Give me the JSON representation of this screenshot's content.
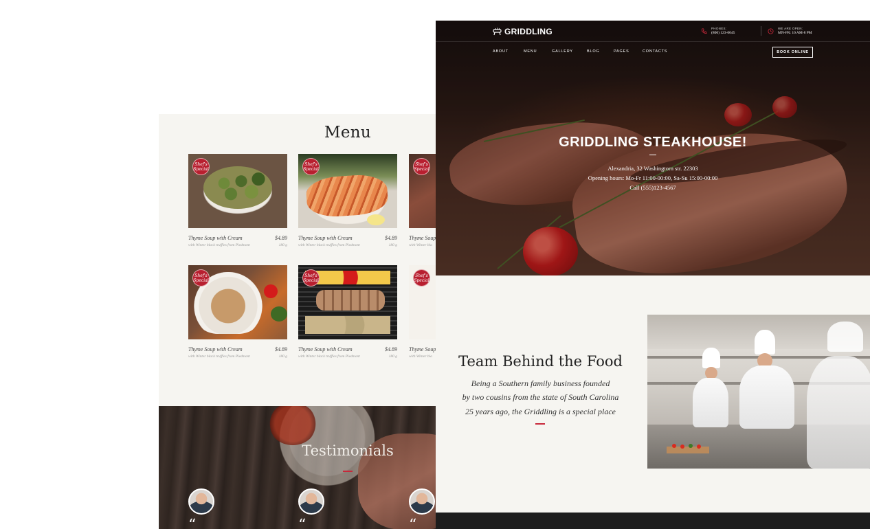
{
  "menu_page": {
    "title": "Menu",
    "badge_text": "Shef's Special",
    "items": [
      {
        "name": "Thyme Soup with Cream",
        "price": "$4.89",
        "desc": "with Winter black truffles from Piedmont",
        "weight": "180 g"
      },
      {
        "name": "Thyme Soup with Cream",
        "price": "$4.89",
        "desc": "with Winter black truffles from Piedmont",
        "weight": "180 g"
      },
      {
        "name": "Thyme Soup",
        "price": "",
        "desc": "with Winter bla",
        "weight": ""
      },
      {
        "name": "Thyme Soup with Cream",
        "price": "$4.89",
        "desc": "with Winter black truffles from Piedmont",
        "weight": "180 g"
      },
      {
        "name": "Thyme Soup with Cream",
        "price": "$4.89",
        "desc": "with Winter black truffles from Piedmont",
        "weight": "180 g"
      },
      {
        "name": "Thyme Soup",
        "price": "",
        "desc": "with Winter bla",
        "weight": ""
      }
    ],
    "testimonials_title": "Testimonials",
    "quote_mark": "“"
  },
  "header": {
    "logo_text": "GRIDDLING",
    "phones_label": "PHONES:",
    "phones_value": "(800) 123-0045",
    "open_label": "WE ARE OPEN:",
    "open_value": "MN-FR: 10 AM-8 PM",
    "nav": [
      "ABOUT",
      "MENU",
      "GALLERY",
      "BLOG",
      "PAGES",
      "CONTACTS"
    ],
    "book_label": "BOOK ONLINE"
  },
  "hero": {
    "title": "GRIDDLING STEAKHOUSE!",
    "address": "Alexandria, 32 Washingtorn str. 22303",
    "hours": "Opening hours:  Mo-Fr 11:00-00:00, Sa-Su 15:00-00:00",
    "call": "Call (555)123-4567"
  },
  "team": {
    "title": "Team Behind the Food",
    "lines": [
      "Being a Southern family business founded",
      "by two cousins from the state of South Carolina",
      "25 years ago, the Griddling is a special place"
    ]
  },
  "icons": {
    "logo": "grill-icon",
    "phone": "phone-icon",
    "clock": "clock-icon",
    "quote": "quote-icon"
  },
  "colors": {
    "accent": "#c8283a",
    "badge": "#b81f2f",
    "dark": "#141010",
    "light_bg": "#f6f5f1"
  }
}
